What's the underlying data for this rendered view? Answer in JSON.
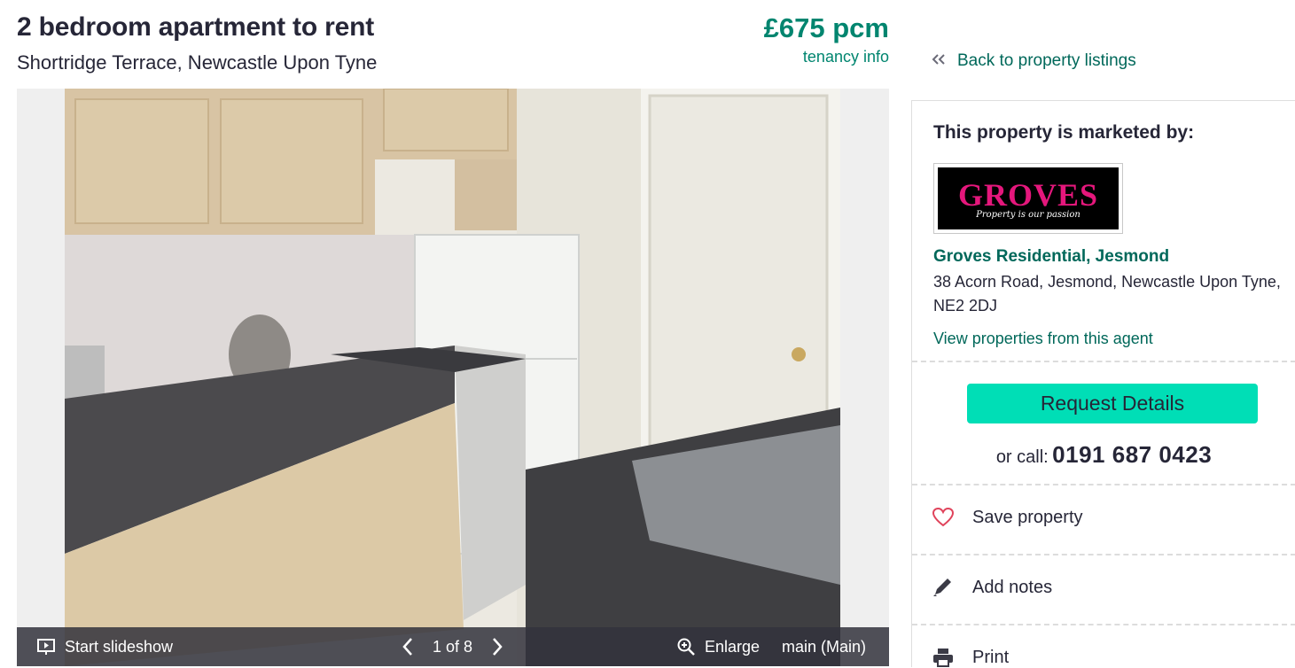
{
  "header": {
    "title": "2 bedroom apartment to rent",
    "address": "Shortridge Terrace, Newcastle Upon Tyne",
    "price": "£675 pcm",
    "tenancy_link": "tenancy info"
  },
  "gallery": {
    "start_slideshow": "Start slideshow",
    "counter": "1 of 8",
    "enlarge": "Enlarge",
    "image_label": "main (Main)"
  },
  "sidebar": {
    "back_link": "Back to property listings",
    "marketed_by": "This property is marketed by:",
    "logo_text": "GROVES",
    "logo_tagline": "Property is our passion",
    "agent_name": "Groves Residential, Jesmond",
    "agent_address": "38 Acorn Road, Jesmond, Newcastle Upon Tyne, NE2 2DJ",
    "agent_link": "View properties from this agent",
    "request_button": "Request Details",
    "call_prefix": "or call:",
    "phone": "0191 687 0423",
    "actions": [
      {
        "label": "Save property",
        "icon": "heart-icon"
      },
      {
        "label": "Add notes",
        "icon": "pencil-icon"
      },
      {
        "label": "Print",
        "icon": "printer-icon"
      }
    ]
  },
  "colors": {
    "brand_green": "#00856f",
    "link_green": "#00685a",
    "button": "#00deb6",
    "logo_pink": "#e5177c",
    "heart": "#e0435b"
  }
}
